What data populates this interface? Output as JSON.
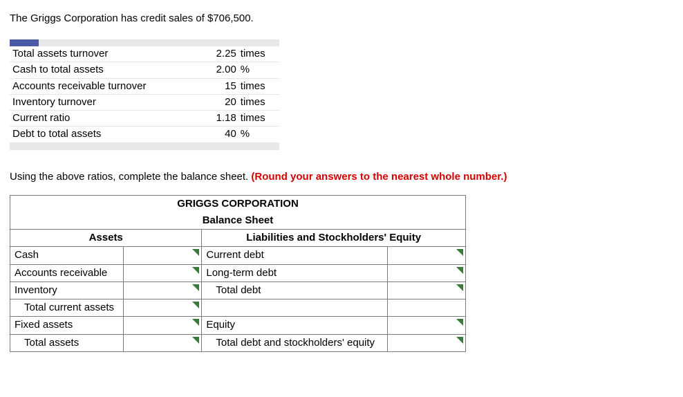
{
  "intro": "The Griggs Corporation has credit sales of $706,500.",
  "ratios": [
    {
      "label": "Total assets turnover",
      "value": "2.25",
      "unit": "times"
    },
    {
      "label": "Cash to total assets",
      "value": "2.00",
      "unit": "%"
    },
    {
      "label": "Accounts receivable turnover",
      "value": "15",
      "unit": "times"
    },
    {
      "label": "Inventory turnover",
      "value": "20",
      "unit": "times"
    },
    {
      "label": "Current ratio",
      "value": "1.18",
      "unit": "times"
    },
    {
      "label": "Debt to total assets",
      "value": "40",
      "unit": "%"
    }
  ],
  "instruction_plain": "Using the above ratios, complete the balance sheet. ",
  "instruction_red": "(Round your answers to the nearest whole number.)",
  "bs": {
    "title": "GRIGGS CORPORATION",
    "subtitle": "Balance Sheet",
    "assets_header": "Assets",
    "liab_header": "Liabilities and Stockholders' Equity",
    "asset_rows": [
      {
        "label": "Cash",
        "indent": 0
      },
      {
        "label": "Accounts receivable",
        "indent": 0
      },
      {
        "label": "Inventory",
        "indent": 0
      },
      {
        "label": "Total current assets",
        "indent": 1
      },
      {
        "label": "Fixed assets",
        "indent": 0
      },
      {
        "label": "Total assets",
        "indent": 1
      }
    ],
    "liab_rows": [
      {
        "label": "Current debt",
        "indent": 0
      },
      {
        "label": "Long-term debt",
        "indent": 0
      },
      {
        "label": "Total debt",
        "indent": 1
      },
      {
        "label": "",
        "indent": 0,
        "blank": true
      },
      {
        "label": "Equity",
        "indent": 0
      },
      {
        "label": "Total debt and stockholders' equity",
        "indent": 1
      }
    ]
  }
}
